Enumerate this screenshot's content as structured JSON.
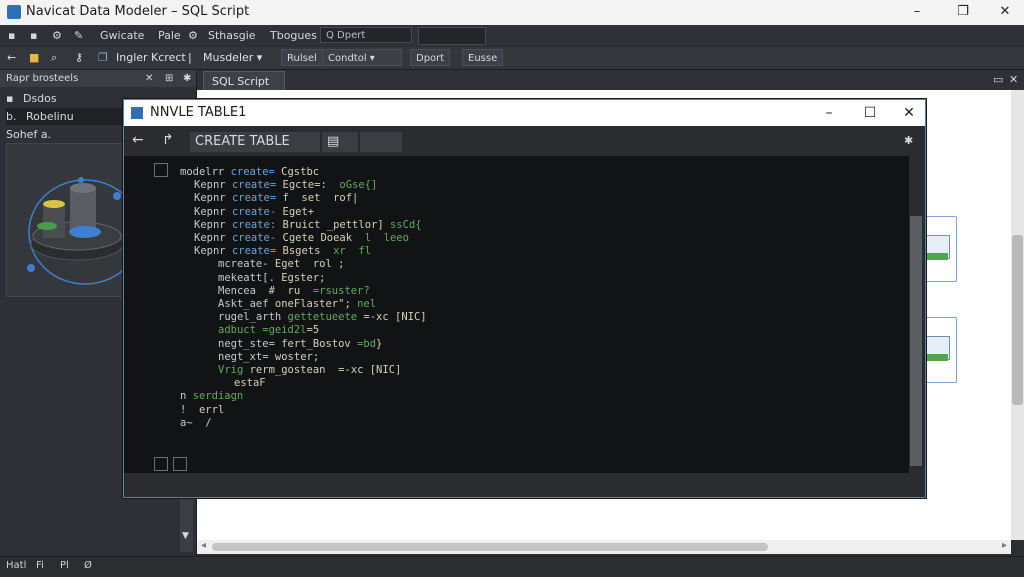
{
  "window": {
    "title": "Navicat Data Modeler – SQL Script",
    "minimize": "–",
    "maximize": "❐",
    "close": "✕"
  },
  "menu": {
    "items": [
      "Gwicate",
      "Pale",
      "Sthasgie",
      "Tbogues"
    ],
    "search_text": "Q Dpert"
  },
  "toolbar": {
    "label1": "Ingler Kcrect",
    "mode_select": "Musdeler ▾",
    "btn_rulsel": "Rulsel",
    "btn_condtol": "Condtol ▾",
    "btn_dport": "Dport",
    "btn_eusse": "Eusse"
  },
  "left_panel": {
    "header": "Rapr brosteels",
    "items": [
      {
        "label": "Dsdos",
        "marker": "▪"
      },
      {
        "label": "Robelinu",
        "marker": "b."
      },
      {
        "label": "Sohef a.",
        "marker": ""
      }
    ]
  },
  "main": {
    "tab_label": "SQL Script"
  },
  "dialog": {
    "title": "NNVLE TABLE1",
    "field": "CREATE TABLE",
    "code_lines": [
      {
        "indent": 0,
        "parts": [
          [
            "kw",
            "modelrr "
          ],
          [
            "fn",
            "create= "
          ],
          [
            "tx",
            "Cgstbc"
          ]
        ]
      },
      {
        "indent": 1,
        "parts": [
          [
            "kw",
            "Kepnr "
          ],
          [
            "fn",
            "create= "
          ],
          [
            "tx",
            "Egcte=:  "
          ],
          [
            "gr",
            "oGse{]"
          ]
        ]
      },
      {
        "indent": 1,
        "parts": [
          [
            "kw",
            "Kepnr "
          ],
          [
            "fn",
            "create= "
          ],
          [
            "tx",
            "f  set  rof|"
          ]
        ]
      },
      {
        "indent": 1,
        "parts": [
          [
            "kw",
            "Kepnr "
          ],
          [
            "fn",
            "create- "
          ],
          [
            "tx",
            "Eget+"
          ]
        ]
      },
      {
        "indent": 1,
        "parts": [
          [
            "kw",
            "Kepnr "
          ],
          [
            "fn",
            "create: "
          ],
          [
            "tx",
            "Bruict _pettlor] "
          ],
          [
            "gr",
            "ssCd{"
          ]
        ]
      },
      {
        "indent": 1,
        "parts": [
          [
            "kw",
            "Kepnr "
          ],
          [
            "fn",
            "create- "
          ],
          [
            "tx",
            "Cgete Doeak  "
          ],
          [
            "gr",
            "l  leeo"
          ]
        ]
      },
      {
        "indent": 1,
        "parts": [
          [
            "kw",
            "Kepnr "
          ],
          [
            "fn",
            "create= "
          ],
          [
            "tx",
            "Bsgets  "
          ],
          [
            "gr",
            "xr  fl"
          ]
        ]
      },
      {
        "indent": 2,
        "parts": [
          [
            "kw",
            "mcreate- "
          ],
          [
            "tx",
            "Eget  rol ;"
          ]
        ]
      },
      {
        "indent": 2,
        "parts": [
          [
            "kw",
            "mekeatt[. "
          ],
          [
            "tx",
            "Egster;"
          ]
        ]
      },
      {
        "indent": 2,
        "parts": [
          [
            "kw",
            "Mencea  "
          ],
          [
            "tx",
            "#  ru  "
          ],
          [
            "gr",
            "=rsuster?"
          ]
        ]
      },
      {
        "indent": 2,
        "parts": [
          [
            "kw",
            "Askt_aef "
          ],
          [
            "tx",
            "oneFlaster\"; "
          ],
          [
            "gr",
            "nel"
          ]
        ]
      },
      {
        "indent": 2,
        "parts": [
          [
            "kw",
            "rugel_arth "
          ],
          [
            "gr",
            "gettetueete "
          ],
          [
            "tx",
            "=-xc [NIC]"
          ]
        ]
      },
      {
        "indent": 2,
        "parts": [
          [
            "gr",
            "adbuct =geid2l"
          ],
          [
            "tx",
            "=5"
          ]
        ]
      },
      {
        "indent": 2,
        "parts": [
          [
            "kw",
            "negt_ste= "
          ],
          [
            "tx",
            "fert_Bostov "
          ],
          [
            "gr",
            "=bd"
          ],
          [
            "tx",
            "}"
          ]
        ]
      },
      {
        "indent": 2,
        "parts": [
          [
            "kw",
            "negt_xt= "
          ],
          [
            "tx",
            "woster;"
          ]
        ]
      },
      {
        "indent": 2,
        "parts": [
          [
            "gr",
            "Vrig "
          ],
          [
            "tx",
            "rerm_gostean  =-xc [NIC]"
          ]
        ]
      },
      {
        "indent": 3,
        "parts": [
          [
            "tx",
            "estaF"
          ]
        ]
      },
      {
        "indent": 0,
        "parts": [
          [
            "kw",
            "n "
          ],
          [
            "gr",
            "serdiagn"
          ]
        ]
      },
      {
        "indent": 0,
        "parts": [
          [
            "kw",
            "!  "
          ],
          [
            "tx",
            "errl"
          ]
        ]
      },
      {
        "indent": 0,
        "parts": [
          [
            "kw",
            "a~  /"
          ]
        ]
      }
    ]
  },
  "status": {
    "items": [
      "Hatl",
      "Fi",
      "Pl",
      "Ø"
    ]
  }
}
